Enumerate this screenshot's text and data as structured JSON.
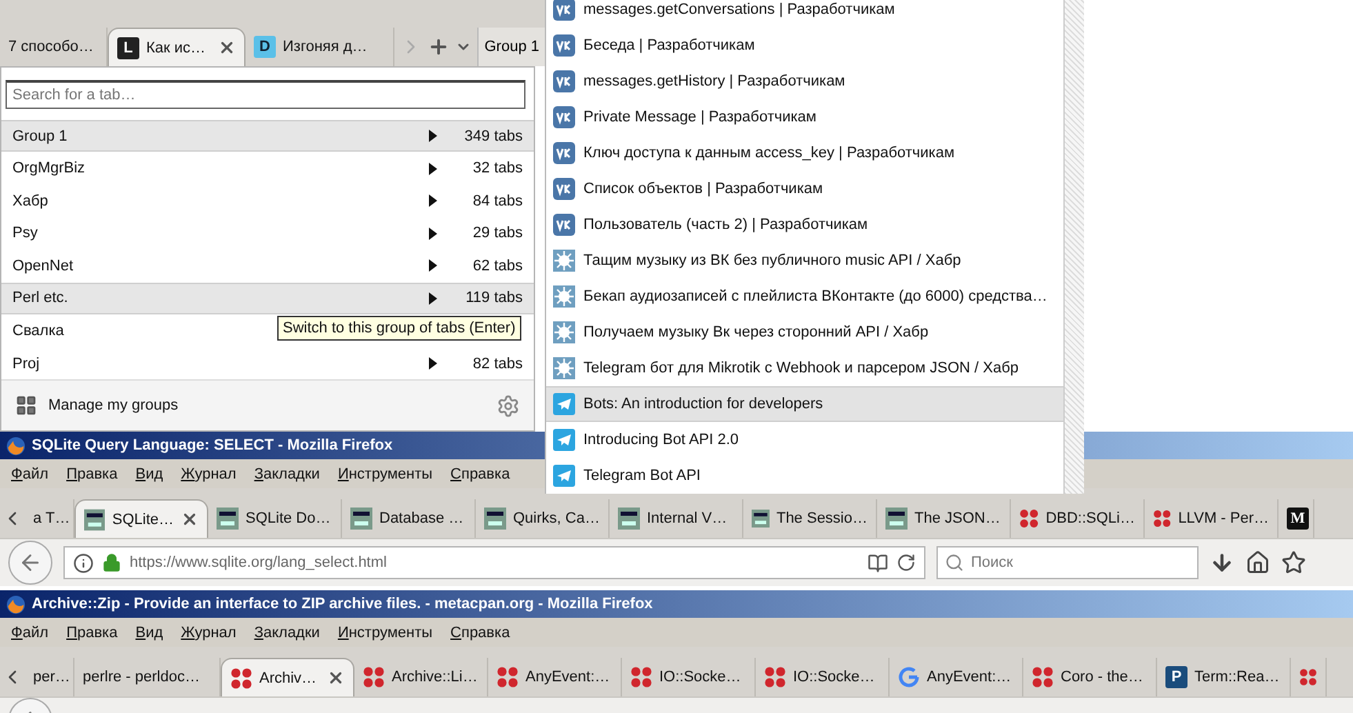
{
  "back_window": {
    "tabs": [
      {
        "label": "7 способо…",
        "kind": "none",
        "selected": false
      },
      {
        "label": "Как ис…",
        "kind": "letter",
        "icon_text": "L",
        "selected": true
      },
      {
        "label": "Изгоняя д…",
        "kind": "dot-letter",
        "icon_text": "D",
        "selected": false
      }
    ],
    "group_button": "Group 1"
  },
  "group_panel": {
    "search": {
      "placeholder": "Search for a tab…"
    },
    "groups": [
      {
        "name": "Group 1",
        "count": "349 tabs",
        "highlighted": true
      },
      {
        "name": "OrgMgrBiz",
        "count": "32 tabs",
        "highlighted": false
      },
      {
        "name": "Хабр",
        "count": "84 tabs",
        "highlighted": false
      },
      {
        "name": "Psy",
        "count": "29 tabs",
        "highlighted": false
      },
      {
        "name": "OpenNet",
        "count": "62 tabs",
        "highlighted": false
      },
      {
        "name": "Perl etc.",
        "count": "119 tabs",
        "highlighted": true
      },
      {
        "name": "Свалка",
        "highlighted": false
      },
      {
        "name": "Proj",
        "count": "82 tabs",
        "highlighted": false
      }
    ],
    "tooltip": "Switch to this group of tabs (Enter)",
    "manage": "Manage my groups"
  },
  "tab_list": {
    "items": [
      {
        "kind": "vk",
        "title": "messages.getConversations | Разработчикам",
        "selected": false
      },
      {
        "kind": "vk",
        "title": "Беседа | Разработчикам",
        "selected": false
      },
      {
        "kind": "vk",
        "title": "messages.getHistory | Разработчикам",
        "selected": false
      },
      {
        "kind": "vk",
        "title": "Private Message | Разработчикам",
        "selected": false
      },
      {
        "kind": "vk",
        "title": "Ключ доступа к данным access_key | Разработчикам",
        "selected": false
      },
      {
        "kind": "vk",
        "title": "Список объектов | Разработчикам",
        "selected": false
      },
      {
        "kind": "vk",
        "title": "Пользователь (часть 2) | Разработчикам",
        "selected": false
      },
      {
        "kind": "habr",
        "title": "Тащим музыку из ВК без публичного music API / Хабр",
        "selected": false
      },
      {
        "kind": "habr",
        "title": "Бекап аудиозаписей с плейлиста ВКонтакте (до 6000) средства…",
        "selected": false
      },
      {
        "kind": "habr",
        "title": "Получаем музыку Вк через сторонний API / Хабр",
        "selected": false
      },
      {
        "kind": "habr",
        "title": "Telegram бот для Mikrotik с Webhook и парсером JSON / Хабр",
        "selected": false
      },
      {
        "kind": "telegram",
        "title": "Bots: An introduction for developers",
        "selected": true
      },
      {
        "kind": "telegram",
        "title": "Introducing Bot API 2.0",
        "selected": false
      },
      {
        "kind": "telegram",
        "title": "Telegram Bot API",
        "selected": false
      }
    ]
  },
  "windows": [
    {
      "title": "SQLite Query Language: SELECT - Mozilla Firefox",
      "menu": [
        "Файл",
        "Правка",
        "Вид",
        "Журнал",
        "Закладки",
        "Инструменты",
        "Справка"
      ],
      "tabs": [
        {
          "label": "a T…",
          "kind": "none",
          "selected": false
        },
        {
          "label": "SQLite…",
          "kind": "sqlite",
          "selected": true
        },
        {
          "label": "SQLite Do…",
          "kind": "sqlite",
          "selected": false
        },
        {
          "label": "Database …",
          "kind": "sqlite",
          "selected": false
        },
        {
          "label": "Quirks, Ca…",
          "kind": "sqlite",
          "selected": false
        },
        {
          "label": "Internal V…",
          "kind": "sqlite",
          "selected": false
        },
        {
          "label": "The Sessio…",
          "kind": "sqlite",
          "selected": false
        },
        {
          "label": "The JSON…",
          "kind": "sqlite",
          "selected": false
        },
        {
          "label": "DBD::SQLi…",
          "kind": "dots",
          "selected": false
        },
        {
          "label": "LLVM - Per…",
          "kind": "dots",
          "selected": false
        },
        {
          "kind": "letter-serif",
          "icon_text": "M",
          "selected": false
        }
      ],
      "nav": {
        "url": "https://www.sqlite.org/lang_select.html",
        "search_placeholder": "Поиск"
      }
    },
    {
      "title": "Archive::Zip - Provide an interface to ZIP archive files. - metacpan.org - Mozilla Firefox",
      "menu": [
        "Файл",
        "Правка",
        "Вид",
        "Журнал",
        "Закладки",
        "Инструменты",
        "Справка"
      ],
      "tabs": [
        {
          "label": "per…",
          "kind": "none",
          "selected": false
        },
        {
          "label": "perlre - perldoc…",
          "kind": "none",
          "selected": false
        },
        {
          "label": "Archiv…",
          "kind": "dots",
          "selected": true
        },
        {
          "label": "Archive::Li…",
          "kind": "dots",
          "selected": false
        },
        {
          "label": "AnyEvent:…",
          "kind": "dots",
          "selected": false
        },
        {
          "label": "IO::Socke…",
          "kind": "dots",
          "selected": false
        },
        {
          "label": "IO::Socke…",
          "kind": "dots",
          "selected": false
        },
        {
          "label": "AnyEvent:…",
          "kind": "google",
          "selected": false
        },
        {
          "label": "Coro - the…",
          "kind": "dots",
          "selected": false
        },
        {
          "label": "Term::Rea…",
          "kind": "letter-box",
          "icon_text": "P",
          "selected": false
        },
        {
          "kind": "dots",
          "selected": false
        }
      ]
    }
  ]
}
